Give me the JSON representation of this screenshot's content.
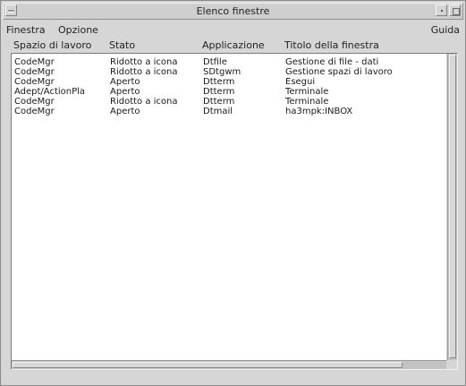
{
  "window": {
    "title": "Elenco finestre"
  },
  "menubar": {
    "items": [
      "Finestra",
      "Opzione"
    ],
    "help": "Guida"
  },
  "table": {
    "columns": [
      "Spazio di lavoro",
      "Stato",
      "Applicazione",
      "Titolo della finestra"
    ],
    "rows": [
      [
        "CodeMgr",
        "Ridotto a icona",
        "Dtfile",
        "Gestione di file - dati"
      ],
      [
        "CodeMgr",
        "Ridotto a icona",
        "SDtgwm",
        "Gestione spazi di lavoro"
      ],
      [
        "CodeMgr",
        "Aperto",
        "Dtterm",
        "Esegui"
      ],
      [
        "Adept/ActionPla",
        "Aperto",
        "Dtterm",
        "Terminale"
      ],
      [
        "CodeMgr",
        "Ridotto a icona",
        "Dtterm",
        "Terminale"
      ],
      [
        "CodeMgr",
        "Aperto",
        "Dtmail",
        "ha3mpk:INBOX"
      ]
    ]
  }
}
